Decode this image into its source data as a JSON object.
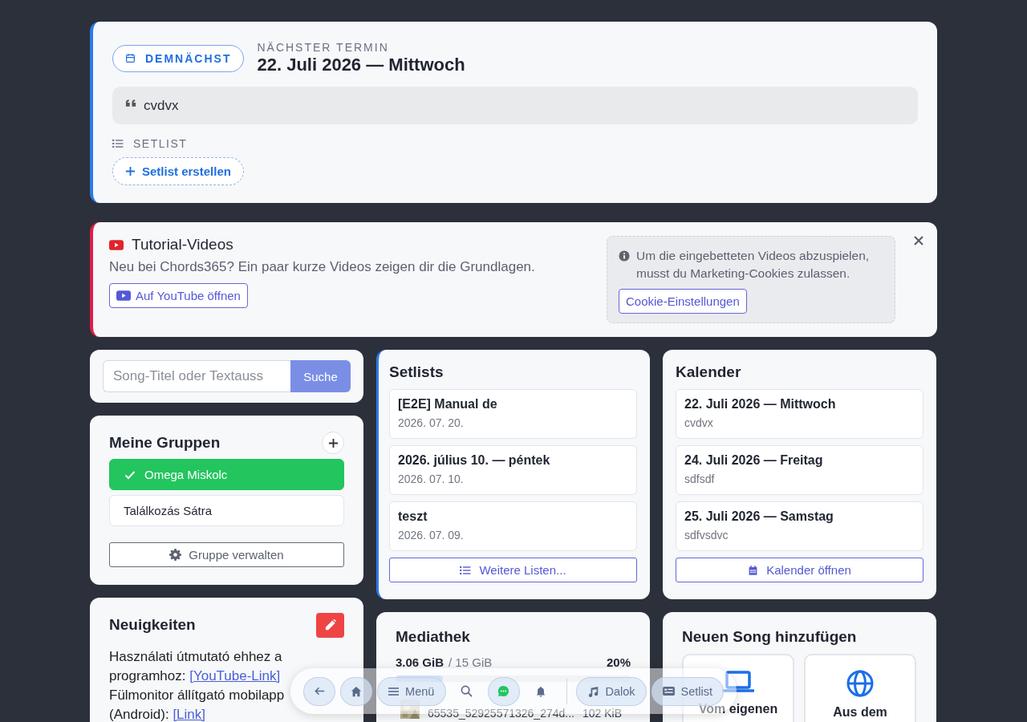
{
  "next_event": {
    "badge": "DEMNÄCHST",
    "label": "NÄCHSTER TERMIN",
    "date": "22. Juli 2026 — Mittwoch",
    "note": "cvdvx",
    "setlist_label": "SETLIST",
    "create_button": "Setlist erstellen"
  },
  "tutorial": {
    "title": "Tutorial-Videos",
    "text": "Neu bei Chords365? Ein paar kurze Videos zeigen dir die Grundlagen.",
    "youtube_button": "Auf YouTube öffnen",
    "cookie_notice": "Um die eingebetteten Videos abzuspielen, musst du Marketing-Cookies zulassen.",
    "cookie_button": "Cookie-Einstellungen"
  },
  "search": {
    "placeholder": "Song-Titel oder Textauss",
    "button": "Suche"
  },
  "groups": {
    "title": "Meine Gruppen",
    "items": [
      {
        "name": "Omega Miskolc",
        "selected": true
      },
      {
        "name": "Találkozás Sátra",
        "selected": false
      }
    ],
    "manage_button": "Gruppe verwalten"
  },
  "news": {
    "title": "Neuigkeiten",
    "lines": [
      {
        "text": "Használati útmutató ehhez a programhoz:",
        "link": "[YouTube-Link]"
      },
      {
        "text": "Fülmonitor állítgató mobilapp (Android):",
        "link": "[Link]"
      }
    ]
  },
  "setlists": {
    "title": "Setlists",
    "items": [
      {
        "name": "[E2E] Manual de",
        "date": "2026. 07. 20."
      },
      {
        "name": "2026. július 10. — péntek",
        "date": "2026. 07. 10."
      },
      {
        "name": "teszt",
        "date": "2026. 07. 09."
      }
    ],
    "more_button": "Weitere Listen..."
  },
  "calendar": {
    "title": "Kalender",
    "items": [
      {
        "date": "22. Juli 2026 — Mittwoch",
        "note": "cvdvx"
      },
      {
        "date": "24. Juli 2026 — Freitag",
        "note": "sdfsdf"
      },
      {
        "date": "25. Juli 2026 — Samstag",
        "note": "sdfvsdvc"
      }
    ],
    "open_button": "Kalender öffnen"
  },
  "media": {
    "title": "Mediathek",
    "used": "3.06 GiB",
    "total": "/ 15 GiB",
    "percent": "20%",
    "level": 0.2,
    "files": [
      {
        "name": "65535_52925571326_274d...",
        "size": "102 KiB"
      }
    ]
  },
  "add_song": {
    "title": "Neuen Song hinzufügen",
    "options": [
      {
        "kind": "laptop",
        "label": "Vom eigenen"
      },
      {
        "kind": "globe",
        "label": "Aus dem"
      }
    ]
  },
  "nav": {
    "items": [
      {
        "kind": "back"
      },
      {
        "kind": "home"
      },
      {
        "kind": "menu",
        "label": "Menü"
      },
      {
        "kind": "search"
      },
      {
        "kind": "chat"
      },
      {
        "kind": "bell"
      },
      {
        "kind": "music",
        "label": "Dalok"
      },
      {
        "kind": "setlist",
        "label": "Setlist"
      }
    ]
  }
}
